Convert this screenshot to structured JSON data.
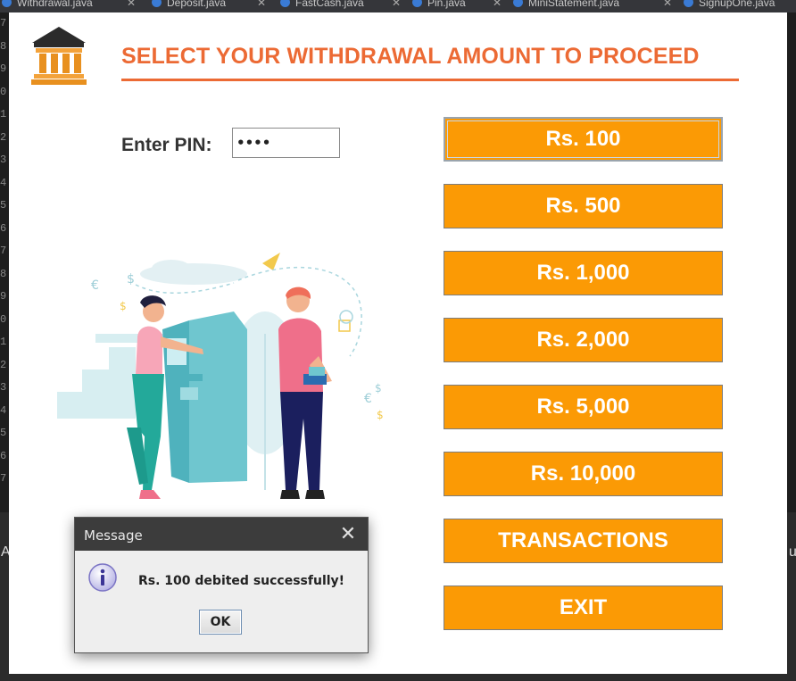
{
  "background": {
    "tabs": [
      {
        "label": "Withdrawal.java",
        "icon": "netbeans-icon"
      },
      {
        "label": "Deposit.java",
        "icon": "netbeans-icon"
      },
      {
        "label": "FastCash.java",
        "icon": "netbeans-icon"
      },
      {
        "label": "Pin.java",
        "icon": "netbeans-icon"
      },
      {
        "label": "MiniStatement.java",
        "icon": "netbeans-icon"
      },
      {
        "label": "SignupOne.java",
        "icon": "netbeans-icon"
      }
    ],
    "gutter_digits": [
      "7",
      "8",
      "9",
      "0",
      "1",
      "2",
      "3",
      "4",
      "5",
      "6",
      "7",
      "8",
      "9",
      "0",
      "1",
      "2",
      "3",
      "4",
      "5",
      "6",
      "7"
    ],
    "left_char": "A",
    "right_char": "u"
  },
  "app": {
    "logo_icon": "bank-building-icon",
    "title": "SELECT YOUR WITHDRAWAL AMOUNT TO PROCEED",
    "title_color": "#ec6a34",
    "pin_label": "Enter PIN:",
    "pin_value": "••••",
    "illustration_icon": "atm-illustration-icon",
    "buttons": [
      {
        "label": "Rs. 100"
      },
      {
        "label": "Rs. 500"
      },
      {
        "label": "Rs. 1,000"
      },
      {
        "label": "Rs. 2,000"
      },
      {
        "label": "Rs. 5,000"
      },
      {
        "label": "Rs. 10,000"
      },
      {
        "label": "TRANSACTIONS"
      },
      {
        "label": "EXIT"
      }
    ],
    "button_color": "#fb9a05"
  },
  "dialog": {
    "title": "Message",
    "close_icon": "close-icon",
    "info_icon": "info-icon",
    "message": "Rs. 100 debited successfully!",
    "ok_label": "OK"
  }
}
